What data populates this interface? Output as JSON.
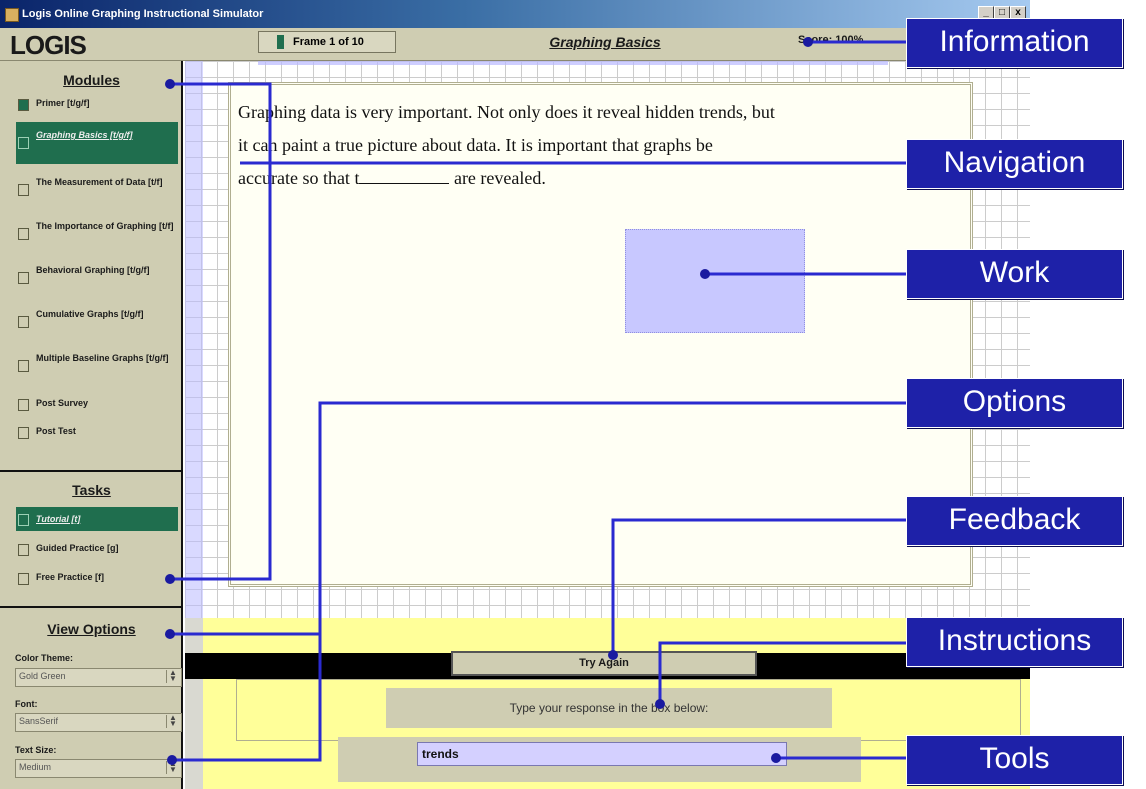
{
  "window": {
    "title": "Logis Online Graphing Instructional Simulator",
    "controls": [
      "_",
      "□",
      "x"
    ]
  },
  "header": {
    "logo": "LOGIS",
    "frame_indicator": "Frame 1 of 10",
    "lesson_title": "Graphing Basics",
    "score": "Score: 100%"
  },
  "modules": {
    "title": "Modules",
    "items": [
      {
        "label": "Primer [t/g/f]"
      },
      {
        "label": "Graphing Basics [t/g/f]"
      },
      {
        "label": "The Measurement of Data [t/f]"
      },
      {
        "label": "The Importance of Graphing [t/f]"
      },
      {
        "label": "Behavioral Graphing [t/g/f]"
      },
      {
        "label": "Cumulative Graphs [t/g/f]"
      },
      {
        "label": "Multiple Baseline Graphs [t/g/f]"
      },
      {
        "label": "Post Survey"
      },
      {
        "label": "Post Test"
      }
    ]
  },
  "tasks": {
    "title": "Tasks",
    "items": [
      {
        "label": "Tutorial [t]"
      },
      {
        "label": "Guided Practice [g]"
      },
      {
        "label": "Free Practice [f]"
      }
    ]
  },
  "view_options": {
    "title": "View Options",
    "color_theme_label": "Color Theme:",
    "color_theme_value": "Gold Green",
    "font_label": "Font:",
    "font_value": "SansSerif",
    "text_size_label": "Text Size:",
    "text_size_value": "Medium"
  },
  "work": {
    "q1": "Graphing data is very important. Not only does it reveal hidden trends, but",
    "q2": "it can paint a true picture about data. It is important that graphs be",
    "q3a": "accurate so that t",
    "q3b": " are revealed."
  },
  "feedback": {
    "button": "Try Again"
  },
  "instructions": {
    "text": "Type your response in the box below:"
  },
  "tools": {
    "response_value": "trends"
  },
  "callouts": [
    "Information",
    "Navigation",
    "Work",
    "Options",
    "Feedback",
    "Instructions",
    "Tools"
  ],
  "colors": {
    "callout_bg": "#1e21a8",
    "active_green": "#1f6e4e",
    "panel_tan": "#cfcdb2",
    "bottom_yellow": "#ffff99"
  }
}
